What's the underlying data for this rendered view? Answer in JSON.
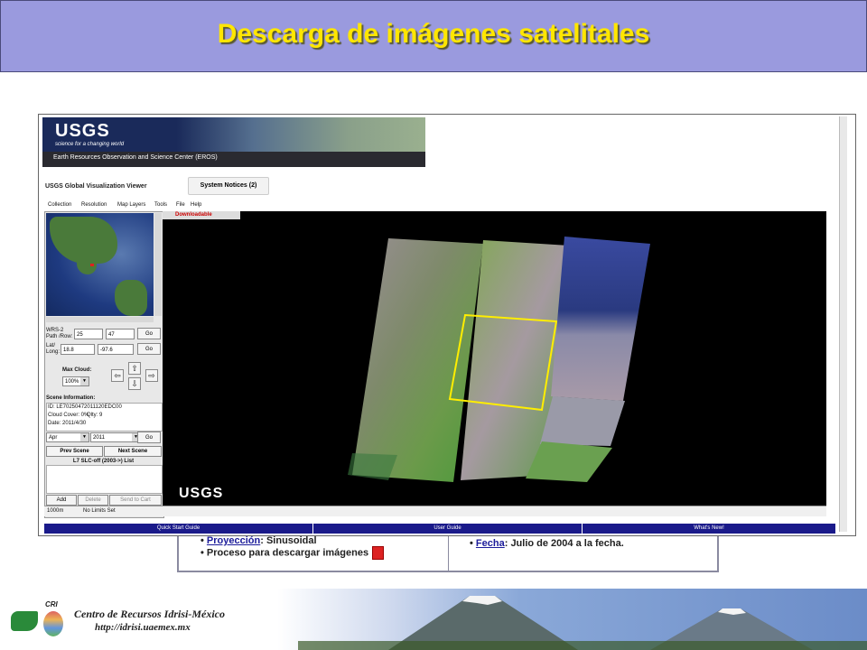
{
  "slide": {
    "title": "Descarga de imágenes satelitales"
  },
  "backdoc": {
    "left_bullets": [
      {
        "label": "Proyección",
        "rest": ": Sinusoidal"
      },
      {
        "label": "Proceso para descargar imágenes",
        "rest": ""
      }
    ],
    "right_bullets": [
      {
        "label": "Fecha",
        "rest": ": Julio de 2004 a la fecha."
      }
    ]
  },
  "app": {
    "banner_logo": "USGS",
    "banner_tagline": "science for a changing world",
    "banner_subtitle": "Earth Resources Observation and Science Center (EROS)",
    "viewer_title": "USGS Global Visualization Viewer",
    "notices_button": "System Notices (2)",
    "menu": [
      "Collection",
      "Resolution",
      "Map Layers",
      "Tools",
      "File",
      "Help"
    ],
    "wrs_label": "WRS-2 Path /Row:",
    "path": "25",
    "row": "47",
    "latlong_label": "Lat/ Long:",
    "lat": "18.8",
    "long": "-97.6",
    "go": "Go",
    "max_cloud_label": "Max Cloud:",
    "max_cloud": "100%",
    "scene_info_label": "Scene Information:",
    "scene_id": "ID: LE70250472011120EDC00",
    "cloud_cover": "Cloud Cover: 0%",
    "qlty": "Qlty: 9",
    "date": "Date: 2011/4/30",
    "month": "Apr",
    "year": "2011",
    "prev_scene": "Prev Scene",
    "next_scene": "Next Scene",
    "list_title": "L7 SLC-off (2003->) List",
    "add": "Add",
    "delete": "Delete",
    "send_to_cart": "Send to Cart",
    "resolution": "1000m",
    "limits": "No Limits Set",
    "downloadable": "Downloadable",
    "map_logo": "USGS",
    "footer_links": [
      "Quick Start Guide",
      "User Guide",
      "What's New!"
    ]
  },
  "footer": {
    "logo_text": "CRI",
    "center_name": "Centro de Recursos Idrisi-México",
    "url": "http://idrisi.uaemex.mx"
  },
  "colors": {
    "title": "#ffe600",
    "header_bg": "#9a9ade",
    "selection": "#ffee00",
    "footer_links_bg": "#1a1a8a"
  }
}
